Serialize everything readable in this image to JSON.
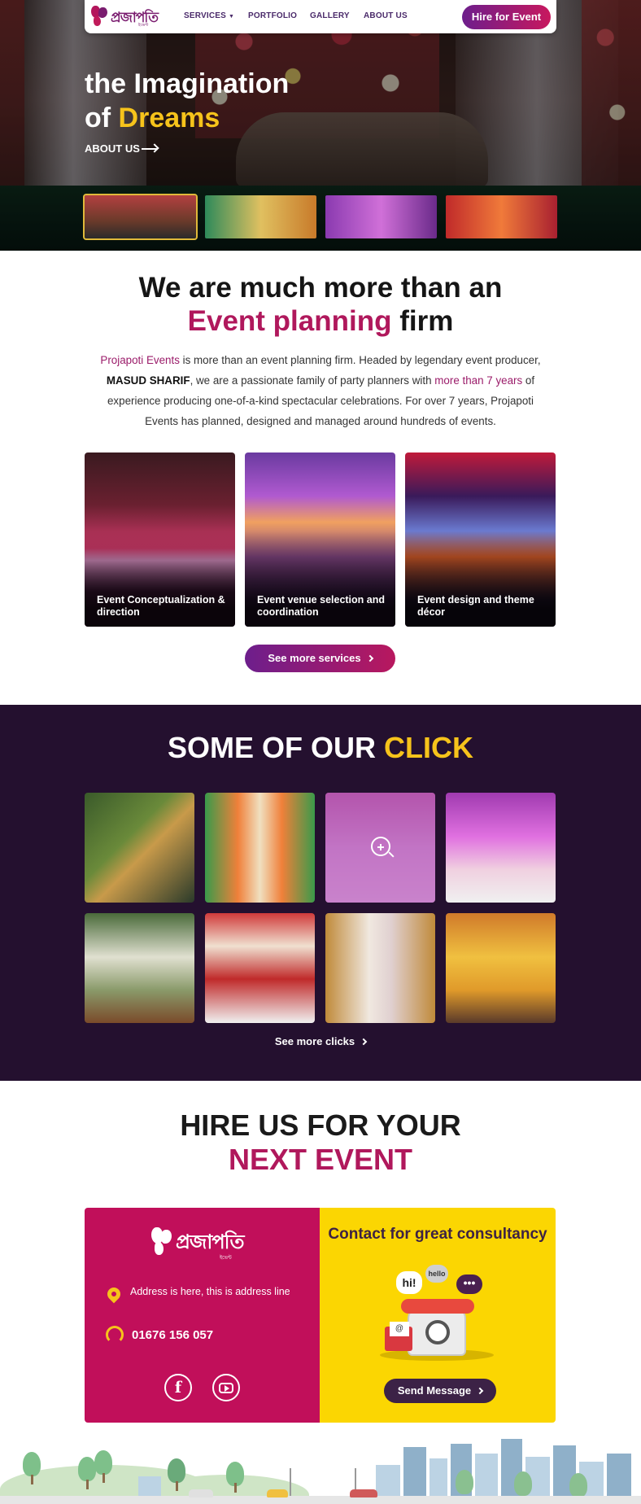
{
  "header": {
    "logo_text": "প্রজাপতি",
    "logo_tagline": "ইভেন্ট",
    "nav": [
      {
        "label": "SERVICES",
        "has_dropdown": true
      },
      {
        "label": "PORTFOLIO"
      },
      {
        "label": "GALLERY"
      },
      {
        "label": "ABOUT US"
      }
    ],
    "cta": "Hire for Event"
  },
  "hero": {
    "title_line1": "the Imagination",
    "title_line2_prefix": "of ",
    "title_line2_highlight": "Dreams",
    "link": "ABOUT US",
    "thumbnails": [
      "thumb-1",
      "thumb-2",
      "thumb-3",
      "thumb-4"
    ],
    "active_thumbnail": 0
  },
  "about": {
    "heading_line1": "We are much more than an",
    "heading_highlight": "Event planning",
    "heading_rest": " firm",
    "brand": "Projapoti Events",
    "p_part1": " is more than an event planning firm. Headed by legendary event producer, ",
    "producer": "MASUD SHARIF",
    "p_part2": ", we are a passionate family of party planners with ",
    "years": "more than 7 years",
    "p_part3": " of experience producing one-of-a-kind spectacular celebrations. For over 7 years, Projapoti Events has planned, designed and managed around hundreds of events."
  },
  "services": {
    "cards": [
      "Event Conceptualization & direction",
      "Event venue selection and coordination",
      "Event design and theme décor"
    ],
    "more": "See more services"
  },
  "gallery": {
    "heading": "SOME OF OUR ",
    "heading_highlight": "CLICK",
    "more": "See more clicks"
  },
  "hire": {
    "heading_line1": "HIRE US FOR YOUR",
    "heading_line2": "NEXT EVENT",
    "address": "Address is here, this is address line",
    "phone": "01676 156 057",
    "social": {
      "facebook": "f"
    },
    "contact_heading": "Contact for great consultancy",
    "bubbles": {
      "hi": "hi!",
      "hello": "hello",
      "dots": "•••"
    },
    "envelope": "@",
    "send": "Send Message"
  },
  "colors": {
    "brand_magenta": "#c10f5a",
    "brand_purple": "#6d1e8c",
    "accent_yellow": "#f6c31b",
    "gallery_bg": "#24102f",
    "contact_yellow": "#fbd602"
  }
}
